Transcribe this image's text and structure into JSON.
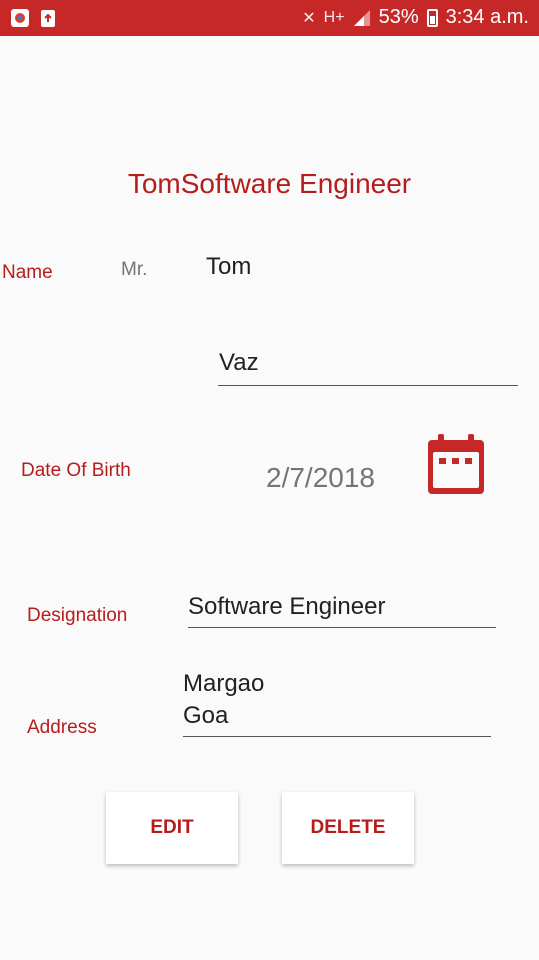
{
  "status": {
    "battery": "53%",
    "time": "3:34 a.m.",
    "network": "H+",
    "icons": [
      "mute-icon",
      "signal-icon",
      "battery-icon",
      "app-icon-1",
      "app-icon-2"
    ]
  },
  "header": {
    "title": "TomSoftware Engineer"
  },
  "form": {
    "name_label": "Name",
    "salutation": "Mr.",
    "first_name": "Tom",
    "last_name": "Vaz",
    "dob_label": "Date Of Birth",
    "dob_value": "2/7/2018",
    "designation_label": "Designation",
    "designation_value": "Software Engineer",
    "address_label": "Address",
    "address_line1": "Margao",
    "address_line2": "Goa"
  },
  "actions": {
    "edit": "EDIT",
    "delete": "DELETE"
  },
  "colors": {
    "accent": "#b71c1c",
    "status_bar": "#c62828"
  }
}
